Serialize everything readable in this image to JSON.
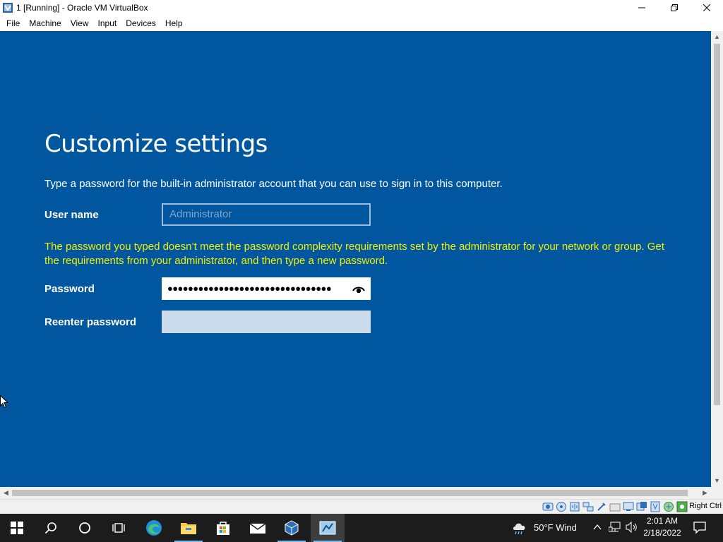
{
  "window": {
    "title": "1 [Running] - Oracle VM VirtualBox",
    "icon": "virtualbox-icon",
    "controls": {
      "minimize": "—",
      "restore": "❐",
      "close": "✕"
    }
  },
  "menu": [
    "File",
    "Machine",
    "View",
    "Input",
    "Devices",
    "Help"
  ],
  "setup": {
    "heading": "Customize settings",
    "instruction": "Type a password for the built-in administrator account that you can use to sign in to this computer.",
    "username_label": "User name",
    "username_placeholder": "Administrator",
    "error": "The password you typed doesn’t meet the password complexity requirements set by the administrator for your network or group. Get the requirements from your administrator, and then type a new password.",
    "password_label": "Password",
    "password_value": "●●●●●●●●●●●●●●●●●●●●●●●●●●●●●●●●",
    "reenter_label": "Reenter password",
    "reenter_value": ""
  },
  "colors": {
    "background": "#01579f",
    "error_text": "#f0f000",
    "taskbar": "#1c1c1c"
  },
  "statusbar": {
    "host_key": "Right Ctrl",
    "icons": [
      "hard-disk-icon",
      "optical-drive-icon",
      "audio-icon",
      "network-icon",
      "usb-icon",
      "shared-folder-icon",
      "display-icon",
      "recording-icon",
      "cpu-icon",
      "mouse-integration-icon",
      "keyboard-icon"
    ]
  },
  "taskbar": {
    "items": [
      "start-icon",
      "search-icon",
      "cortana-icon",
      "task-view-icon",
      "edge-icon",
      "file-explorer-icon",
      "store-icon",
      "mail-icon",
      "virtualbox-taskbar-icon",
      "server-manager-icon"
    ],
    "weather": "50°F  Wind",
    "time": "2:01 AM",
    "date": "2/18/2022"
  }
}
